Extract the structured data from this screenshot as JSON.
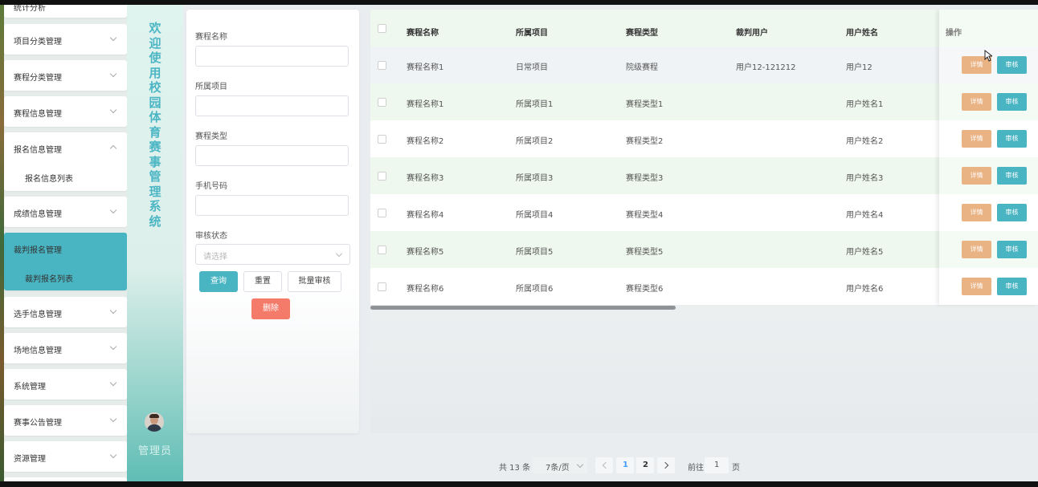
{
  "sidebar": {
    "top_partial": "统计分析",
    "menus": [
      {
        "label": "项目分类管理"
      },
      {
        "label": "赛程分类管理"
      },
      {
        "label": "赛程信息管理"
      },
      {
        "label": "报名信息管理",
        "sub": "报名信息列表"
      },
      {
        "label": "成绩信息管理"
      },
      {
        "label": "裁判报名管理",
        "sub": "裁判报名列表",
        "active": true
      },
      {
        "label": "选手信息管理"
      },
      {
        "label": "场地信息管理"
      },
      {
        "label": "系统管理"
      },
      {
        "label": "赛事公告管理"
      },
      {
        "label": "资源管理"
      }
    ]
  },
  "brand": {
    "title": "欢迎使用校园体育赛事管理系统",
    "user": "管理员"
  },
  "search": {
    "fields": [
      {
        "label": "赛程名称"
      },
      {
        "label": "所属项目"
      },
      {
        "label": "赛程类型"
      },
      {
        "label": "手机号码"
      }
    ],
    "status_label": "审核状态",
    "status_placeholder": "请选择",
    "buttons": {
      "query": "查询",
      "reset": "重置",
      "batch_audit": "批量审核",
      "delete": "删除"
    }
  },
  "table": {
    "columns": [
      "赛程名称",
      "所属项目",
      "赛程类型",
      "裁判用户",
      "用户姓名",
      "操作"
    ],
    "rows": [
      [
        "赛程名称1",
        "日常项目",
        "院级赛程",
        "用户12-121212",
        "用户12"
      ],
      [
        "赛程名称1",
        "所属项目1",
        "赛程类型1",
        "",
        "用户姓名1"
      ],
      [
        "赛程名称2",
        "所属项目2",
        "赛程类型2",
        "",
        "用户姓名2"
      ],
      [
        "赛程名称3",
        "所属项目3",
        "赛程类型3",
        "",
        "用户姓名3"
      ],
      [
        "赛程名称4",
        "所属项目4",
        "赛程类型4",
        "",
        "用户姓名4"
      ],
      [
        "赛程名称5",
        "所属项目5",
        "赛程类型5",
        "",
        "用户姓名5"
      ],
      [
        "赛程名称6",
        "所属项目6",
        "赛程类型6",
        "",
        "用户姓名6"
      ]
    ],
    "detail_label": "详情",
    "audit_label": "审核"
  },
  "pagination": {
    "total": "共 13 条",
    "page_size": "7条/页",
    "pages": [
      "1",
      "2"
    ],
    "current_page": "1",
    "goto_label": "前往",
    "goto_value": "1",
    "page_unit": "页"
  },
  "colors": {
    "accent": "#49b4c2",
    "detail": "#e9b384",
    "danger": "#f47a6a",
    "header_bg": "#eef8ee"
  }
}
